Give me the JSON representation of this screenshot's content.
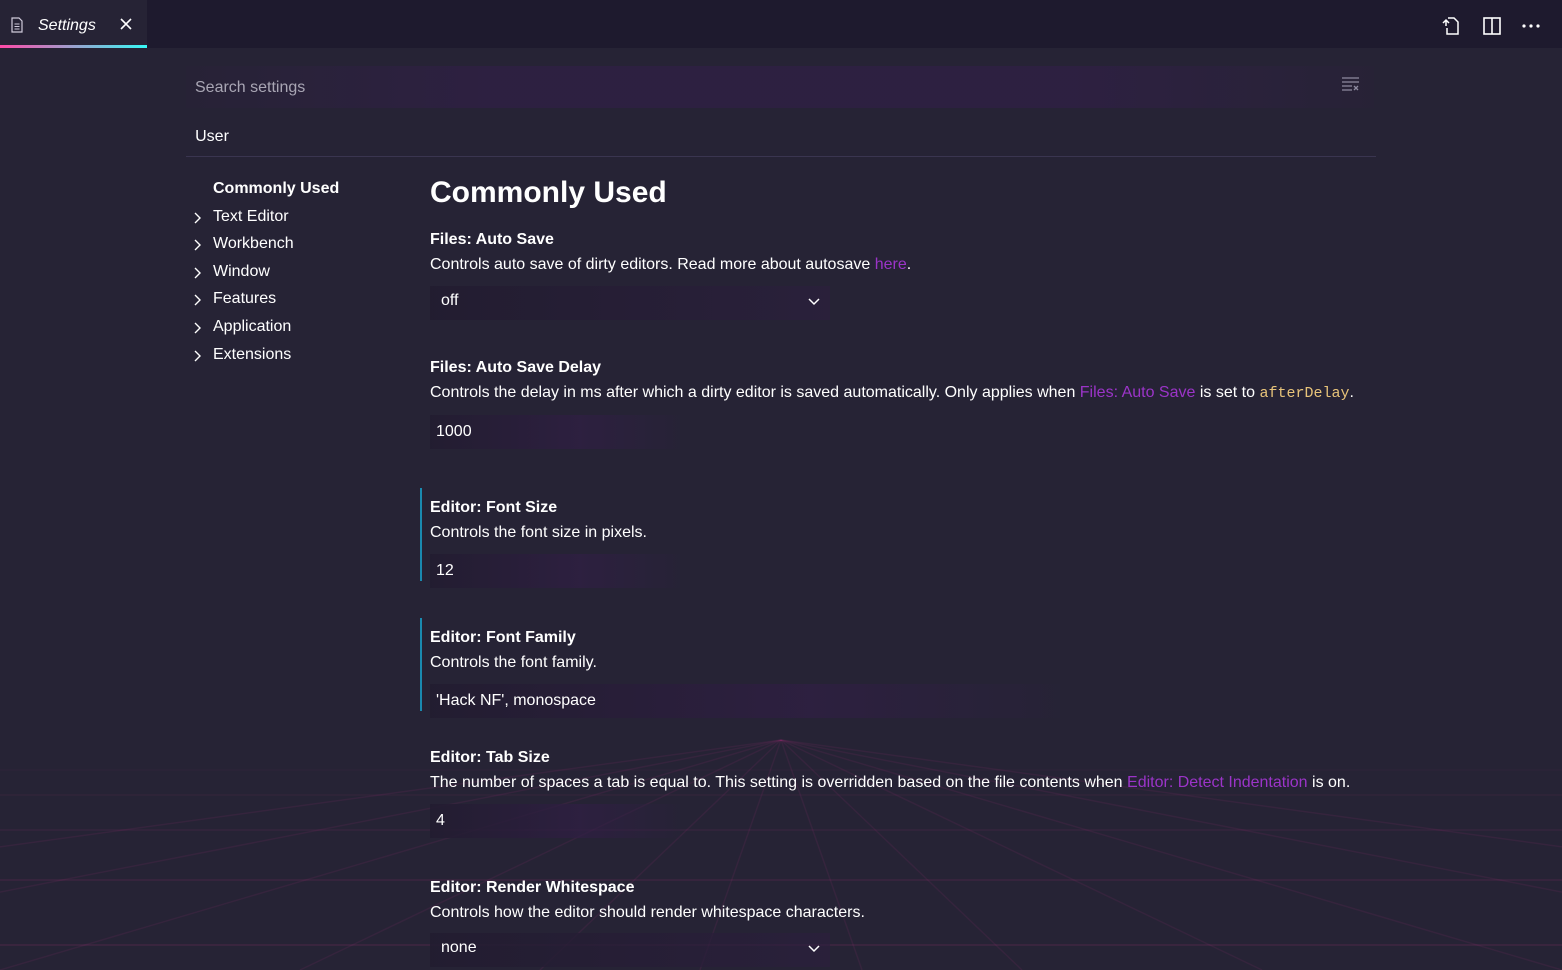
{
  "editor_tab": {
    "label": "Settings",
    "close_glyph": "✕"
  },
  "toolbar": {
    "icons": [
      "open-settings-json-icon",
      "split-editor-icon",
      "more-actions-icon"
    ]
  },
  "search": {
    "placeholder": "Search settings",
    "value": ""
  },
  "scope_tabs": [
    {
      "label": "User",
      "active": true
    }
  ],
  "toc": {
    "items": [
      {
        "label": "Commonly Used",
        "active": true,
        "expandable": false
      },
      {
        "label": "Text Editor",
        "active": false,
        "expandable": true
      },
      {
        "label": "Workbench",
        "active": false,
        "expandable": true
      },
      {
        "label": "Window",
        "active": false,
        "expandable": true
      },
      {
        "label": "Features",
        "active": false,
        "expandable": true
      },
      {
        "label": "Application",
        "active": false,
        "expandable": true
      },
      {
        "label": "Extensions",
        "active": false,
        "expandable": true
      }
    ]
  },
  "main": {
    "title": "Commonly Used",
    "settings": [
      {
        "title": "Files: Auto Save",
        "desc_before": "Controls auto save of dirty editors. Read more about autosave ",
        "desc_link": "here",
        "desc_after": ".",
        "control": "select",
        "value": "off"
      },
      {
        "title": "Files: Auto Save Delay",
        "desc_before": "Controls the delay in ms after which a dirty editor is saved automatically. Only applies when ",
        "desc_link": "Files: Auto Save",
        "desc_middle": " is set to ",
        "desc_code": "afterDelay",
        "desc_after": ".",
        "control": "number",
        "value": "1000"
      },
      {
        "title": "Editor: Font Size",
        "desc": "Controls the font size in pixels.",
        "control": "number",
        "value": "12",
        "modified": true
      },
      {
        "title": "Editor: Font Family",
        "desc": "Controls the font family.",
        "control": "text",
        "value": "'Hack NF', monospace",
        "modified": true
      },
      {
        "title": "Editor: Tab Size",
        "desc_before": "The number of spaces a tab is equal to. This setting is overridden based on the file contents when ",
        "desc_link": "Editor: Detect Indentation",
        "desc_after": " is on.",
        "control": "number",
        "value": "4"
      },
      {
        "title": "Editor: Render Whitespace",
        "desc": "Controls how the editor should render whitespace characters.",
        "control": "select",
        "value": "none"
      }
    ]
  },
  "colors": {
    "background": "#262335",
    "titlebar": "#1e1a2e",
    "link": "#9b34c8",
    "code": "#e8c47a",
    "modified_bar": "#1a8ab0",
    "tab_underline_start": "#ff4aa8",
    "tab_underline_end": "#36f9f6"
  }
}
